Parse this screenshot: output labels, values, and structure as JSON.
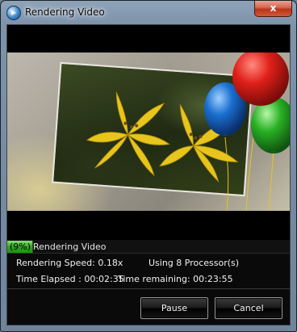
{
  "window": {
    "title": "Rendering Video",
    "close_label": "x"
  },
  "progress": {
    "percent_label": "(9%)",
    "label": "Rendering Video",
    "fraction": 0.09
  },
  "stats": {
    "speed": "Rendering Speed: 0.18x",
    "processors": "Using 8 Processor(s)",
    "elapsed": "Time Elapsed  : 00:02:35",
    "remaining": "Time remaining: 00:23:55"
  },
  "buttons": {
    "pause": "Pause",
    "cancel": "Cancel"
  },
  "colors": {
    "progress": "#2fa41e",
    "close": "#c7432a",
    "balloon_red": "#e0201a",
    "balloon_blue": "#1a6fd0",
    "balloon_green": "#28b024",
    "lily": "#e8c51c"
  }
}
